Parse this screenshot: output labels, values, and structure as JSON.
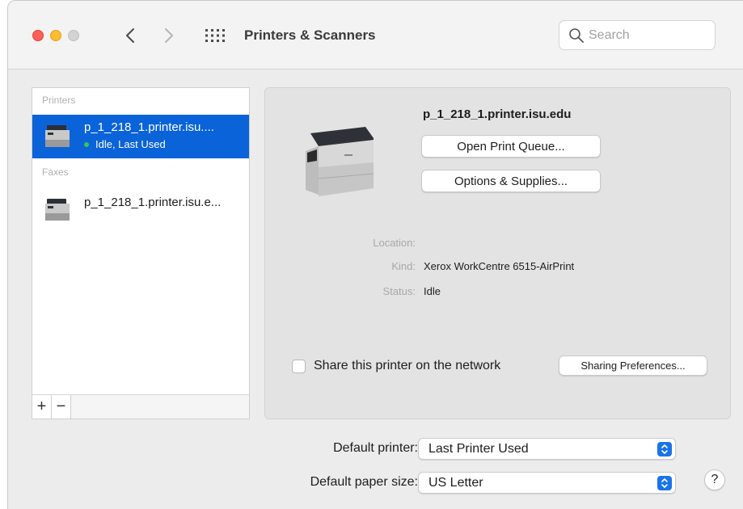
{
  "window": {
    "title": "Printers & Scanners",
    "search_placeholder": "Search"
  },
  "sidebar": {
    "printers_label": "Printers",
    "faxes_label": "Faxes",
    "printers": [
      {
        "name": "p_1_218_1.printer.isu....",
        "status": "Idle, Last Used",
        "selected": true
      }
    ],
    "faxes": [
      {
        "name": "p_1_218_1.printer.isu.e...",
        "selected": false
      }
    ],
    "add_label": "+",
    "remove_label": "−"
  },
  "detail": {
    "printer_name": "p_1_218_1.printer.isu.edu",
    "open_queue_label": "Open Print Queue...",
    "options_label": "Options & Supplies...",
    "location_label": "Location:",
    "location_value": "",
    "kind_label": "Kind:",
    "kind_value": "Xerox WorkCentre 6515-AirPrint",
    "status_label": "Status:",
    "status_value": "Idle",
    "share_label": "Share this printer on the network",
    "share_checked": false,
    "sharing_prefs_label": "Sharing Preferences..."
  },
  "defaults": {
    "printer_label": "Default printer:",
    "printer_value": "Last Printer Used",
    "paper_label": "Default paper size:",
    "paper_value": "US Letter"
  },
  "help_label": "?",
  "colors": {
    "selection": "#0a63d8",
    "status_idle": "#34c759",
    "close": "#fe5f57",
    "minimize": "#febc2e"
  }
}
